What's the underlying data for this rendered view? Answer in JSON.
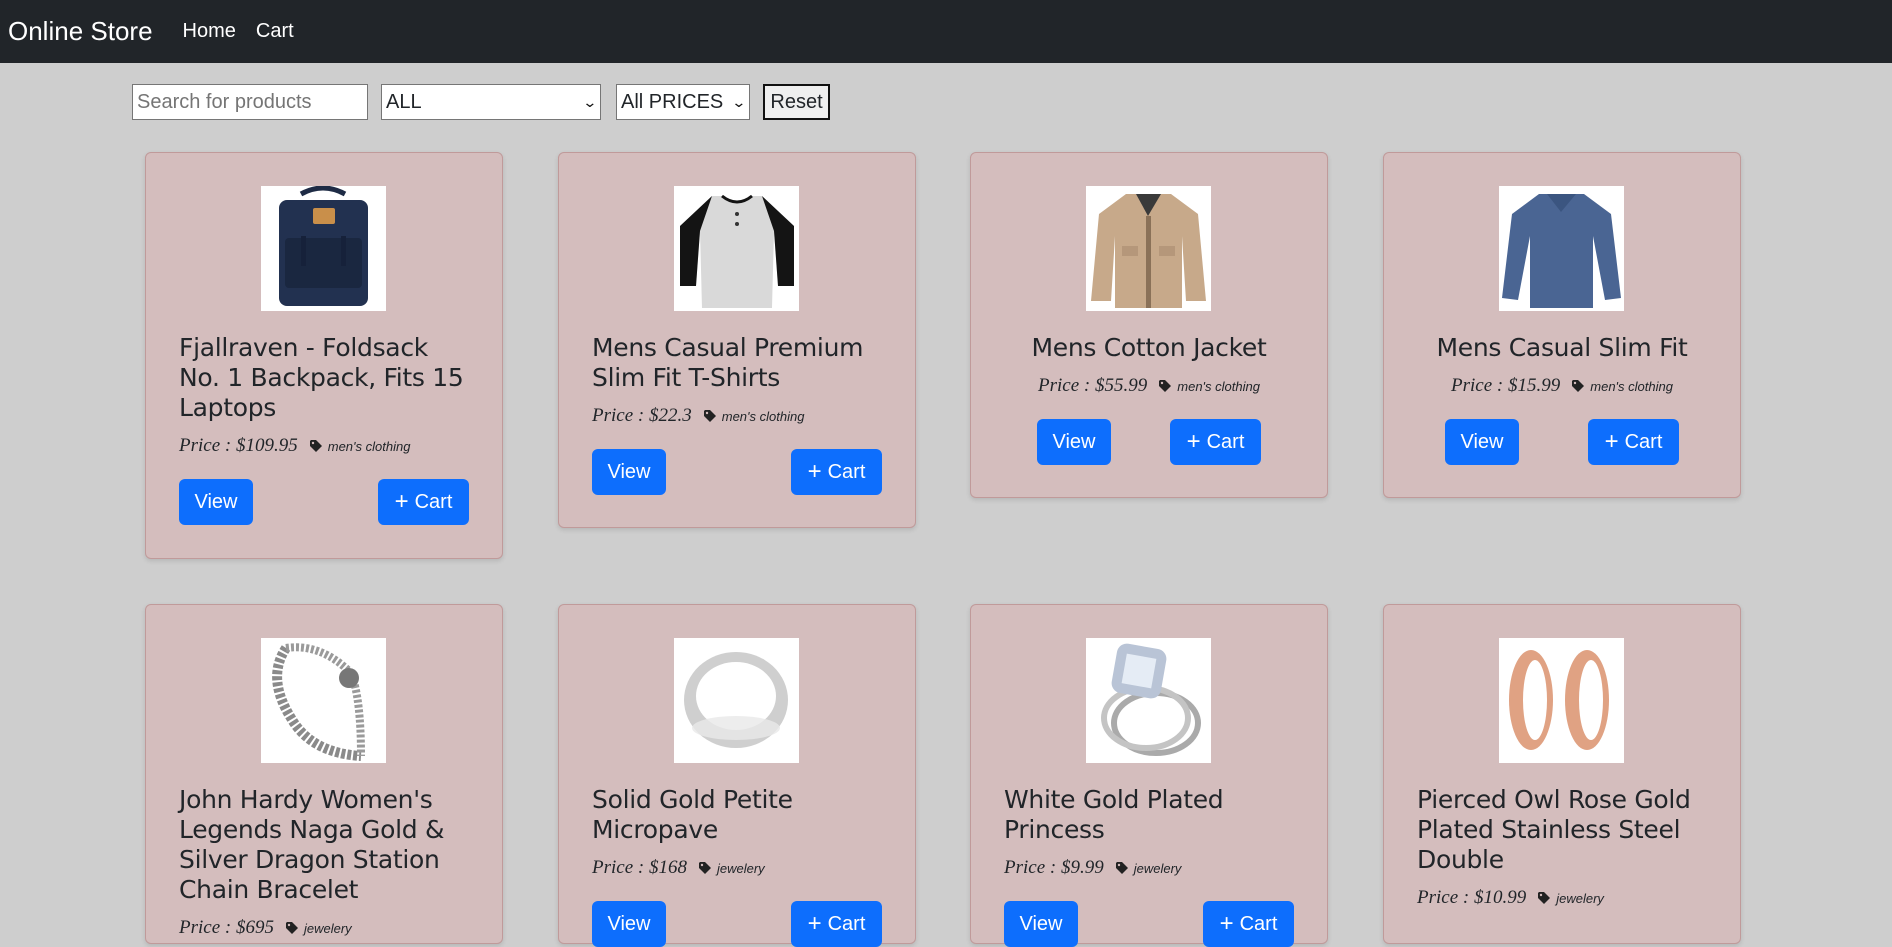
{
  "navbar": {
    "brand": "Online Store",
    "links": [
      "Home",
      "Cart"
    ]
  },
  "filters": {
    "search_placeholder": "Search for products",
    "category_selected": "ALL",
    "price_selected": "All PRICES",
    "reset_label": "Reset"
  },
  "labels": {
    "view": "View",
    "cart": "Cart"
  },
  "products": [
    {
      "title": "Fjallraven - Foldsack No. 1 Backpack, Fits 15 Laptops",
      "price": "Price : $109.95",
      "category": "men's clothing"
    },
    {
      "title": "Mens Casual Premium Slim Fit T-Shirts",
      "price": "Price : $22.3",
      "category": "men's clothing"
    },
    {
      "title": "Mens Cotton Jacket",
      "price": "Price : $55.99",
      "category": "men's clothing"
    },
    {
      "title": "Mens Casual Slim Fit",
      "price": "Price : $15.99",
      "category": "men's clothing"
    },
    {
      "title": "John Hardy Women's Legends Naga Gold & Silver Dragon Station Chain Bracelet",
      "price": "Price : $695",
      "category": "jewelery"
    },
    {
      "title": "Solid Gold Petite Micropave",
      "price": "Price : $168",
      "category": "jewelery"
    },
    {
      "title": "White Gold Plated Princess",
      "price": "Price : $9.99",
      "category": "jewelery"
    },
    {
      "title": "Pierced Owl Rose Gold Plated Stainless Steel Double",
      "price": "Price : $10.99",
      "category": "jewelery"
    }
  ]
}
